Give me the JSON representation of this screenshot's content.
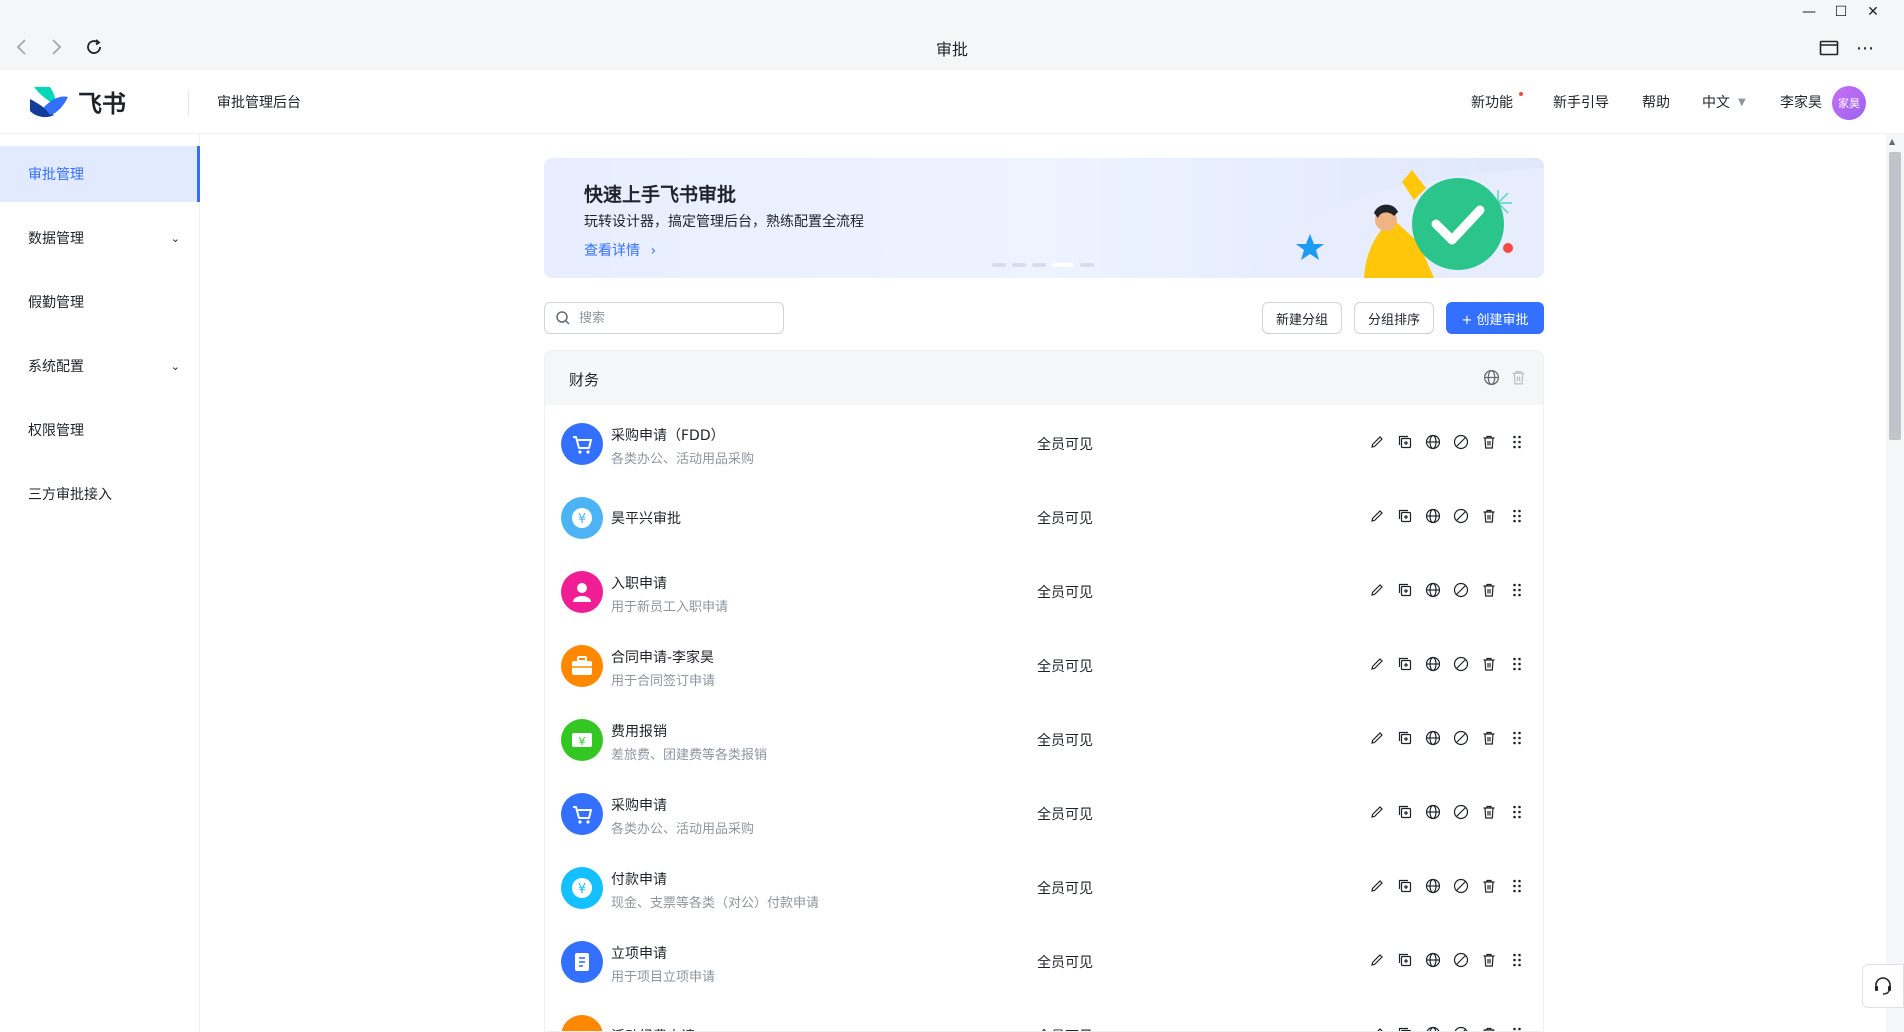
{
  "window": {
    "title": "审批",
    "minimize": "—",
    "maximize": "☐",
    "close": "✕",
    "more": "⋯"
  },
  "header": {
    "logo_text": "飞书",
    "app_name": "审批管理后台",
    "links": [
      "新功能",
      "新手引导",
      "帮助",
      "中文"
    ],
    "user_name": "李家昊",
    "avatar_text": "家昊"
  },
  "sidebar": {
    "items": [
      {
        "label": "审批管理",
        "active": true,
        "expandable": false
      },
      {
        "label": "数据管理",
        "active": false,
        "expandable": true
      },
      {
        "label": "假勤管理",
        "active": false,
        "expandable": false
      },
      {
        "label": "系统配置",
        "active": false,
        "expandable": true
      },
      {
        "label": "权限管理",
        "active": false,
        "expandable": false
      },
      {
        "label": "三方审批接入",
        "active": false,
        "expandable": false
      }
    ]
  },
  "banner": {
    "title": "快速上手飞书审批",
    "subtitle": "玩转设计器，搞定管理后台，熟练配置全流程",
    "link": "查看详情",
    "slides": 5,
    "active_slide": 4
  },
  "toolbar": {
    "search_placeholder": "搜索",
    "new_group": "新建分组",
    "sort_group": "分组排序",
    "create": "+ 创建审批"
  },
  "group": {
    "name": "财务",
    "rows": [
      {
        "title": "采购申请（FDD）",
        "desc": "各类办公、活动用品采购",
        "visibility": "全员可见",
        "icon": "cart-icon",
        "color": "#3370ff"
      },
      {
        "title": "昊平兴审批",
        "desc": "",
        "visibility": "全员可见",
        "icon": "yen-icon",
        "color": "#4cb4f5"
      },
      {
        "title": "入职申请",
        "desc": "用于新员工入职申请",
        "visibility": "全员可见",
        "icon": "person-icon",
        "color": "#f01d94"
      },
      {
        "title": "合同申请-李家昊",
        "desc": "用于合同签订申请",
        "visibility": "全员可见",
        "icon": "briefcase-icon",
        "color": "#ff8800"
      },
      {
        "title": "费用报销",
        "desc": "差旅费、团建费等各类报销",
        "visibility": "全员可见",
        "icon": "bill-icon",
        "color": "#34c724"
      },
      {
        "title": "采购申请",
        "desc": "各类办公、活动用品采购",
        "visibility": "全员可见",
        "icon": "cart-icon",
        "color": "#3370ff"
      },
      {
        "title": "付款申请",
        "desc": "现金、支票等各类（对公）付款申请",
        "visibility": "全员可见",
        "icon": "yen-icon",
        "color": "#14c0ff"
      },
      {
        "title": "立项申请",
        "desc": "用于项目立项申请",
        "visibility": "全员可见",
        "icon": "document-icon",
        "color": "#3370ff"
      },
      {
        "title": "活动经费申请",
        "desc": "",
        "visibility": "全员可见",
        "icon": "car-icon",
        "color": "#ff8800"
      }
    ]
  }
}
